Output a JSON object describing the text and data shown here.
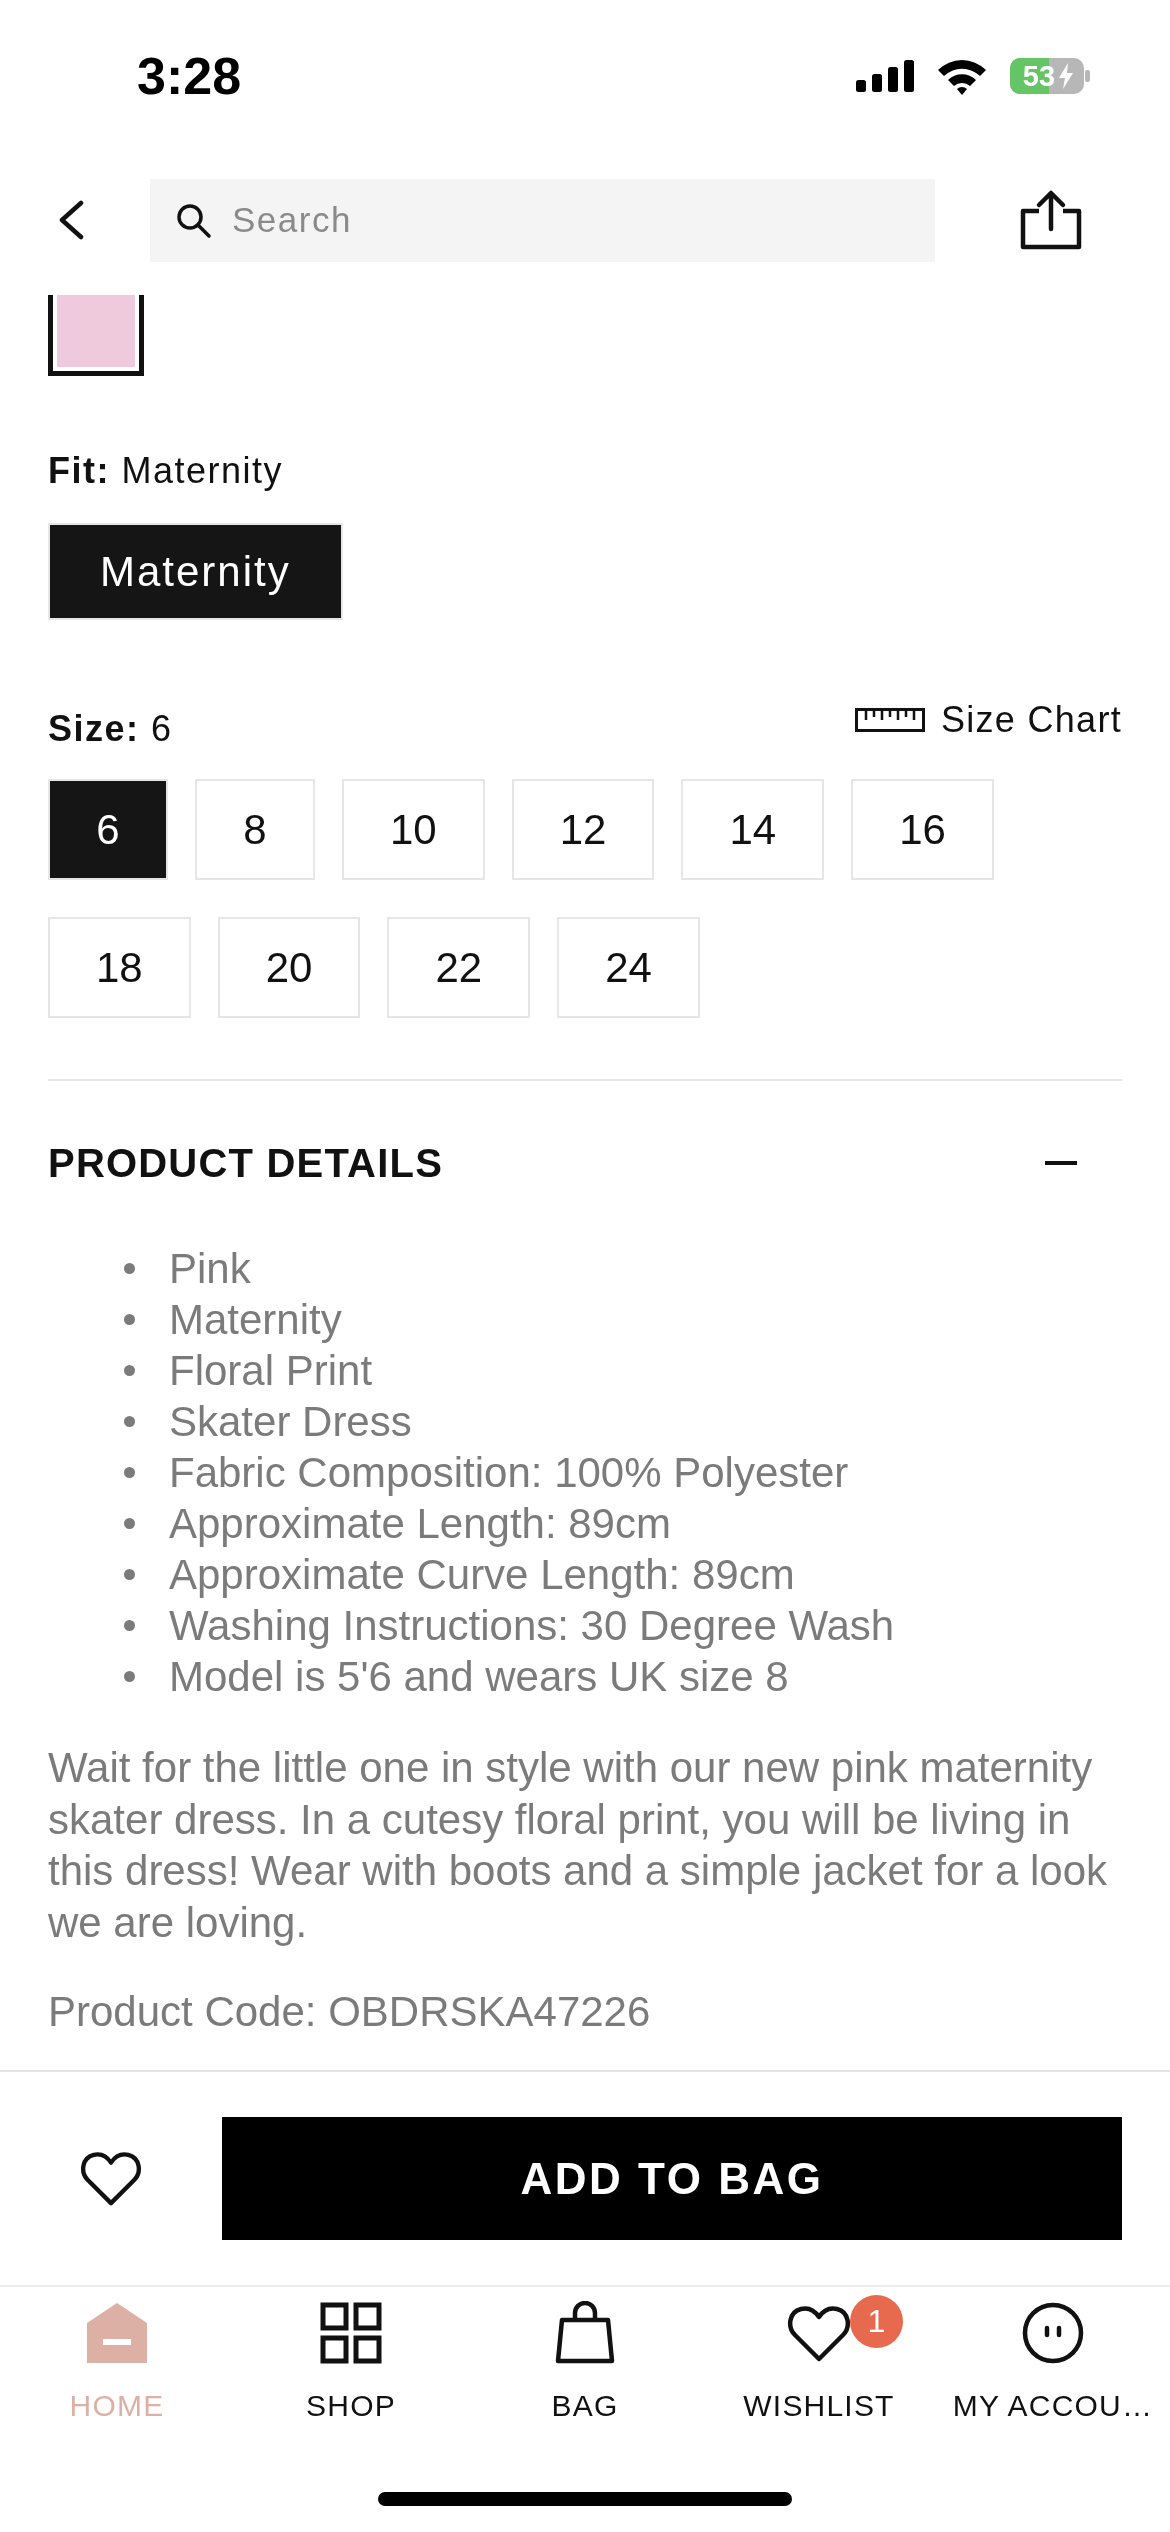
{
  "status_bar": {
    "time": "3:28",
    "battery": "53",
    "charging": true
  },
  "header": {
    "search": {
      "placeholder": "Search"
    }
  },
  "colours": [
    {
      "color": "#efcadd",
      "selected": true
    }
  ],
  "fit": {
    "heading": "**Fit:** Maternity",
    "options": [
      {
        "label": "Maternity",
        "selected": true
      }
    ]
  },
  "size": {
    "heading": "**Size:** 6",
    "size_chart": "Size Chart",
    "options": [
      {
        "label": "6",
        "selected": true
      },
      {
        "label": "8",
        "selected": false
      },
      {
        "label": "10",
        "selected": false
      },
      {
        "label": "12",
        "selected": false
      },
      {
        "label": "14",
        "selected": false
      },
      {
        "label": "16",
        "selected": false
      },
      {
        "label": "18",
        "selected": false
      },
      {
        "label": "20",
        "selected": false
      },
      {
        "label": "22",
        "selected": false
      },
      {
        "label": "24",
        "selected": false
      }
    ]
  },
  "product_details": {
    "title": "PRODUCT DETAILS",
    "expanded": true,
    "bullets": [
      "Pink",
      "Maternity",
      "Floral Print",
      "Skater Dress",
      "Fabric Composition: 100% Polyester",
      "Approximate Length: 89cm",
      "Approximate Curve Length: 89cm",
      "Washing Instructions: 30 Degree Wash",
      "Model is 5'6 and wears UK size 8"
    ],
    "description": "Wait for the little one in style with our new pink maternity skater dress. In a cutesy floral print, you will be living in this dress! Wear with boots and a simple jacket for a look we are loving.",
    "product_code": "Product Code: OBDRSKA47226"
  },
  "action_bar": {
    "button": "ADD TO BAG"
  },
  "tab_bar": [
    {
      "label": "HOME",
      "selected": true
    },
    {
      "label": "SHOP",
      "selected": false
    },
    {
      "label": "BAG",
      "selected": false
    },
    {
      "label": "WISHLIST",
      "selected": false,
      "badge": "1"
    },
    {
      "label": "MY ACCOU…",
      "selected": false
    }
  ]
}
